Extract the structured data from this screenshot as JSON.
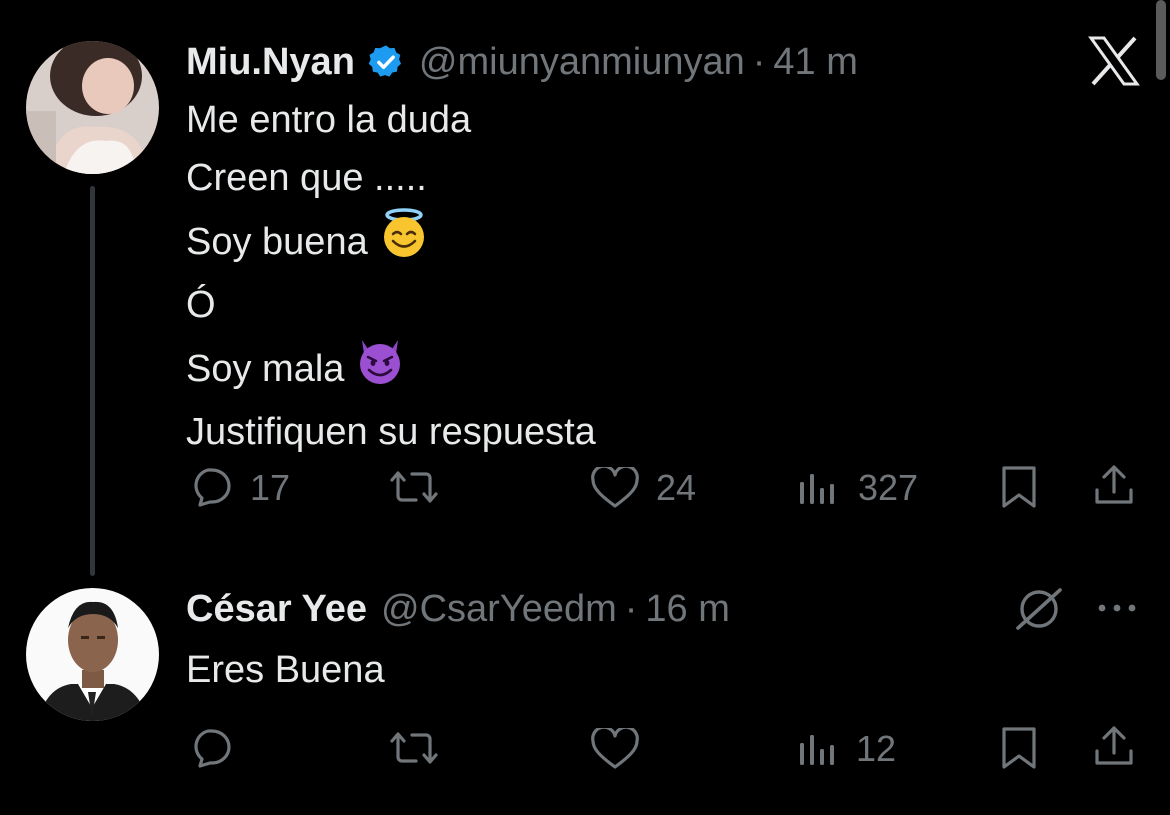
{
  "tweet": {
    "author_name": "Miu.Nyan",
    "verified": true,
    "handle": "@miunyanmiunyan",
    "separator": "·",
    "time": "41 m",
    "lines": [
      "Me entro la duda",
      "Creen que .....",
      "Soy buena",
      "Ó",
      "Soy mala",
      "Justifiquen su respuesta"
    ],
    "emojis": {
      "angel": "smiling-face-with-halo",
      "devil": "smiling-face-with-horns"
    },
    "actions": {
      "replies": "17",
      "reposts": "",
      "likes": "24",
      "views": "327"
    }
  },
  "reply": {
    "author_name": "César Yee",
    "handle": "@CsarYeedm",
    "separator": "·",
    "time": "16 m",
    "text": "Eres Buena",
    "actions": {
      "replies": "",
      "reposts": "",
      "likes": "",
      "views": "12"
    }
  },
  "colors": {
    "background": "#000000",
    "text": "#e7e9ea",
    "muted": "#71767b",
    "verified": "#1d9bf0"
  },
  "icons": [
    "x-logo-icon",
    "verified-badge-icon",
    "reply-icon",
    "repost-icon",
    "like-icon",
    "views-icon",
    "bookmark-icon",
    "share-icon",
    "grok-icon",
    "more-icon"
  ]
}
